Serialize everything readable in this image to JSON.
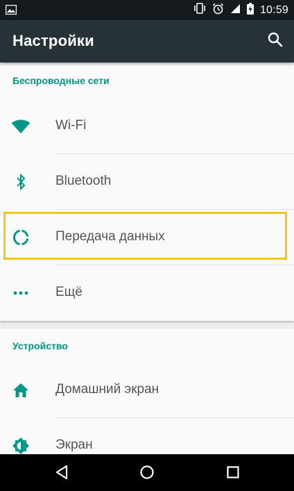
{
  "status_bar": {
    "time": "10:59",
    "icons": [
      "image-icon",
      "vibrate-icon",
      "alarm-icon",
      "signal-icon",
      "battery-charging-icon"
    ]
  },
  "app_bar": {
    "title": "Настройки",
    "search_icon": "search-icon"
  },
  "sections": [
    {
      "header": "Беспроводные сети",
      "items": [
        {
          "label": "Wi-Fi",
          "icon": "wifi-icon"
        },
        {
          "label": "Bluetooth",
          "icon": "bluetooth-icon"
        },
        {
          "label": "Передача данных",
          "icon": "data-usage-icon",
          "highlighted": true
        },
        {
          "label": "Ещё",
          "icon": "more-icon"
        }
      ]
    },
    {
      "header": "Устройство",
      "items": [
        {
          "label": "Домашний экран",
          "icon": "home-icon"
        },
        {
          "label": "Экран",
          "icon": "brightness-icon"
        }
      ]
    }
  ],
  "colors": {
    "accent": "#009688",
    "app_bar": "#263238",
    "status_bar": "#151a1c",
    "highlight_border": "#f5c518"
  },
  "nav_bar": {
    "buttons": [
      "back-icon",
      "home-circle-icon",
      "recents-icon"
    ]
  }
}
